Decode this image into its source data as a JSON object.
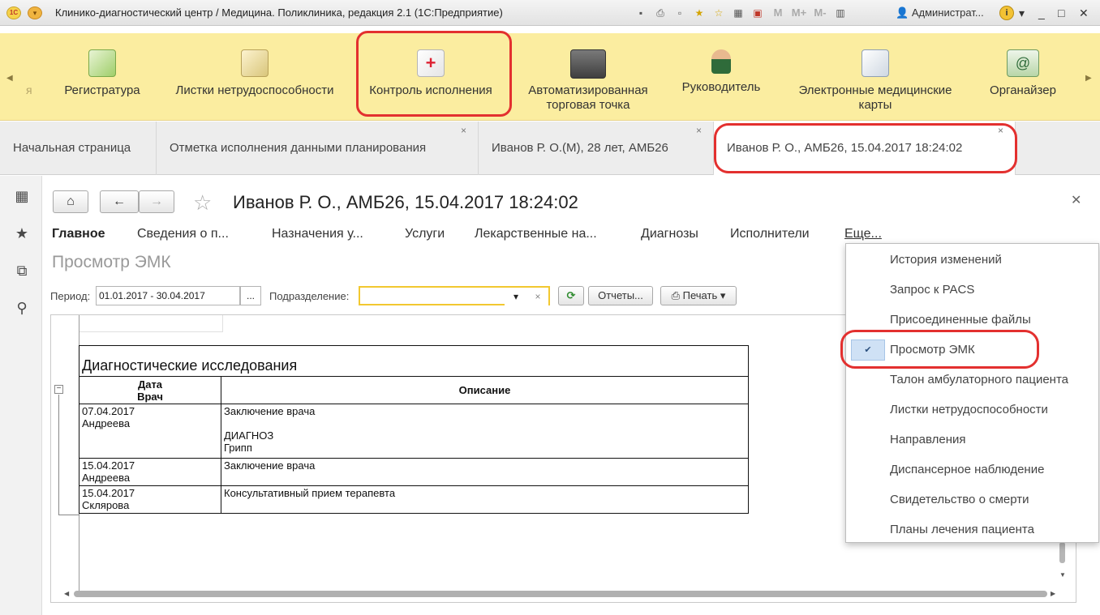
{
  "window": {
    "title": "Клинико-диагностический центр / Медицина. Поликлиника, редакция 2.1  (1С:Предприятие)",
    "user": "Администрат...",
    "logo_text": "1С",
    "toolbar_m_labels": [
      "M",
      "M+",
      "M-"
    ],
    "info_glyph": "i",
    "min_glyph": "_",
    "max_glyph": "□",
    "close_glyph": "✕"
  },
  "sections": {
    "faded_label": "я",
    "items": [
      {
        "label": "Регистратура",
        "icon": "clipboard-question-icon"
      },
      {
        "label": "Листки нетрудоспособности",
        "icon": "documents-icon"
      },
      {
        "label": "Контроль исполнения",
        "icon": "medical-kit-icon"
      },
      {
        "label": "Автоматизированная торговая точка",
        "icon": "cash-register-icon"
      },
      {
        "label": "Руководитель",
        "icon": "manager-icon"
      },
      {
        "label": "Электронные медицинские карты",
        "icon": "medical-records-icon"
      },
      {
        "label": "Органайзер",
        "icon": "organizer-mail-icon"
      }
    ]
  },
  "tabs": [
    {
      "label": "Начальная страница"
    },
    {
      "label": "Отметка исполнения данными планирования"
    },
    {
      "label": "Иванов Р. О.(М), 28 лет, АМБ26"
    },
    {
      "label": "Иванов Р. О., АМБ26, 15.04.2017 18:24:02"
    }
  ],
  "form": {
    "title": "Иванов Р. О., АМБ26, 15.04.2017 18:24:02",
    "subtitle": "Просмотр ЭМК",
    "commands": [
      "Главное",
      "Сведения о п...",
      "Назначения у...",
      "Услуги",
      "Лекарственные на...",
      "Диагнозы",
      "Исполнители",
      "Еще..."
    ],
    "filters": {
      "period_label": "Период:",
      "period_value": "01.01.2017 - 30.04.2017",
      "ellipsis": "...",
      "department_label": "Подразделение:",
      "department_value": "",
      "reports_label": "Отчеты...",
      "print_label": "Печать"
    }
  },
  "report": {
    "caption": "Диагностические исследования",
    "col_date": "Дата",
    "col_doctor": "Врач",
    "col_desc": "Описание",
    "rows": [
      {
        "date": "07.04.2017",
        "doctor": "Андреева",
        "desc": [
          "Заключение врача",
          "",
          "ДИАГНОЗ",
          "Грипп"
        ]
      },
      {
        "date": "15.04.2017",
        "doctor": "Андреева",
        "desc": [
          "Заключение врача"
        ]
      },
      {
        "date": "15.04.2017",
        "doctor": "Склярова",
        "desc": [
          "Консультативный прием терапевта"
        ]
      }
    ]
  },
  "more_menu": {
    "items": [
      {
        "label": "История изменений",
        "checked": false
      },
      {
        "label": "Запрос к PACS",
        "checked": false
      },
      {
        "label": "Присоединенные файлы",
        "checked": false
      },
      {
        "label": "Просмотр ЭМК",
        "checked": true
      },
      {
        "label": "Талон амбулаторного пациента",
        "checked": false
      },
      {
        "label": "Листки нетрудоспособности",
        "checked": false
      },
      {
        "label": "Направления",
        "checked": false
      },
      {
        "label": "Диспансерное наблюдение",
        "checked": false
      },
      {
        "label": "Свидетельство о смерти",
        "checked": false
      },
      {
        "label": "Планы лечения пациента",
        "checked": false
      }
    ]
  },
  "colors": {
    "sections_bg": "#fbeda0",
    "highlight": "#e3302f",
    "checked_bg": "#cfe1f5"
  }
}
